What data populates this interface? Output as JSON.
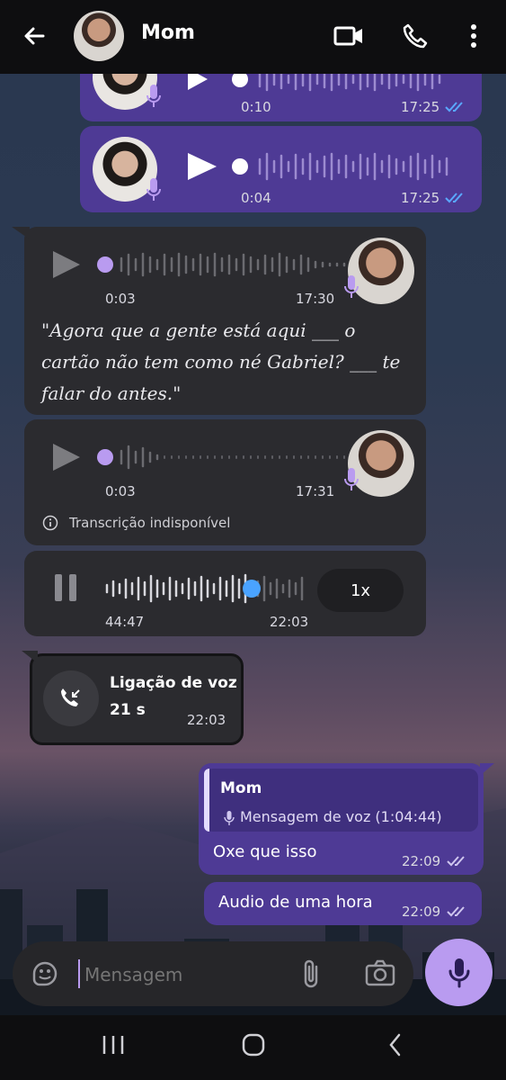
{
  "header": {
    "contact_name": "Mom",
    "icons": [
      "back-arrow-icon",
      "video-call-icon",
      "phone-icon",
      "more-icon"
    ]
  },
  "messages": {
    "voice_out_1": {
      "duration": "0:10",
      "time": "17:25"
    },
    "voice_out_2": {
      "duration": "0:04",
      "time": "17:25"
    },
    "voice_in_1": {
      "duration": "0:03",
      "time": "17:30",
      "transcript": "\"Agora que a gente está aqui ___ o cartão não tem como né Gabriel? ___ te falar do antes.\""
    },
    "voice_in_2": {
      "duration": "0:03",
      "time": "17:31",
      "transcript_status": "Transcrição indisponível"
    },
    "voice_in_3": {
      "position": "44:47",
      "time": "22:03",
      "speed": "1x",
      "progress": 0.72
    },
    "call": {
      "label": "Ligação de voz",
      "duration": "21 s",
      "time": "22:03"
    },
    "reply": {
      "quoted_name": "Mom",
      "quoted_text": "Mensagem de voz (1:04:44)",
      "text": "Oxe que isso",
      "time": "22:09"
    },
    "text_out": {
      "text": "Audio de uma hora",
      "time": "22:09"
    }
  },
  "composer": {
    "placeholder": "Mensagem"
  },
  "colors": {
    "purple_bubble": "#4e3a95",
    "dark_bubble": "#2b2b2f",
    "accent": "#b99bf0",
    "read_ticks": "#5aa8ff"
  }
}
